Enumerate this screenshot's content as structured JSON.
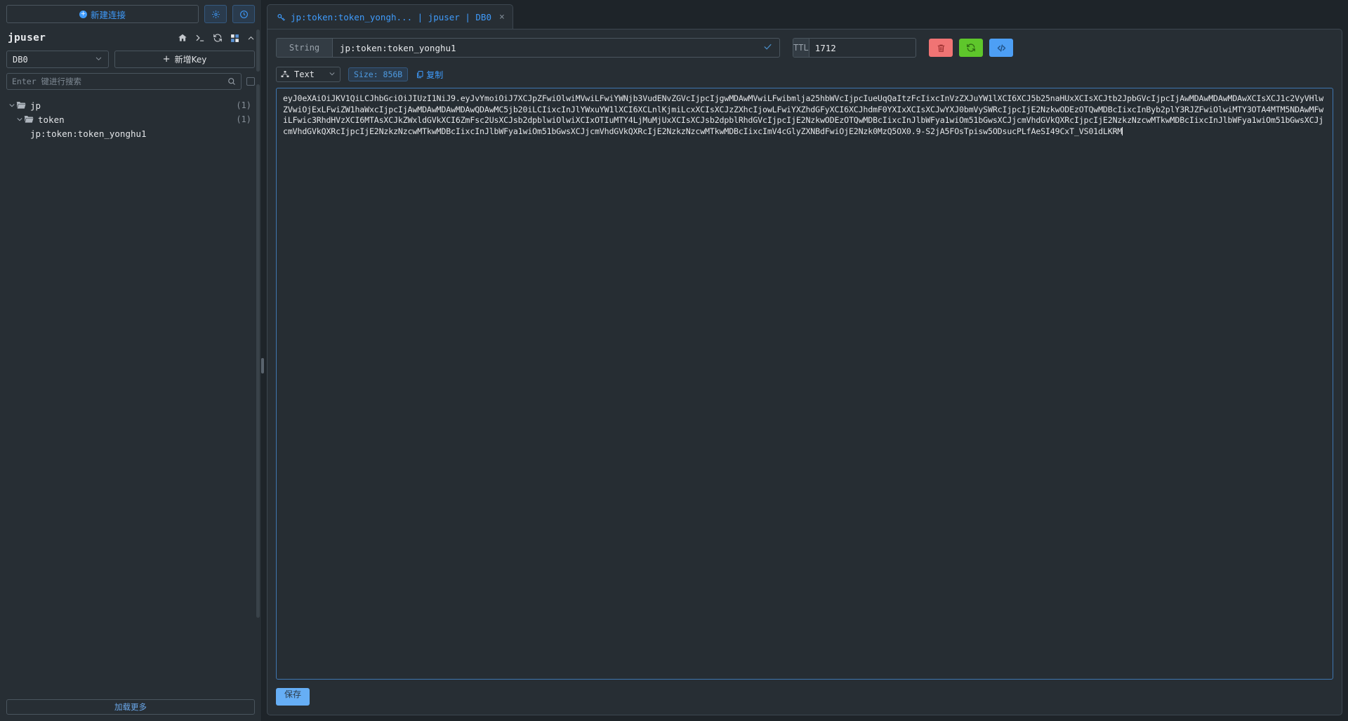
{
  "sidebar": {
    "new_connection_label": "新建连接",
    "settings_icon": "gear-icon",
    "history_icon": "clock-icon",
    "connection_title": "jpuser",
    "title_icons": [
      "home-icon",
      "terminal-icon",
      "refresh-icon",
      "grid-icon",
      "chevron-up-icon"
    ],
    "db_select_value": "DB0",
    "add_key_label": "新增Key",
    "search_placeholder": "Enter 键进行搜索",
    "tree": [
      {
        "label": "jp",
        "count": "(1)",
        "type": "folder",
        "depth": 0,
        "expanded": true
      },
      {
        "label": "token",
        "count": "(1)",
        "type": "folder",
        "depth": 1,
        "expanded": true
      },
      {
        "label": "jp:token:token_yonghu1",
        "count": "",
        "type": "key",
        "depth": 2,
        "expanded": false
      }
    ],
    "load_more_label": "加载更多"
  },
  "tabs": [
    {
      "icon": "key-icon",
      "label": "jp:token:token_yongh...  |  jpuser  |  DB0",
      "close": "×",
      "active": true
    }
  ],
  "key_detail": {
    "type_label": "String",
    "key_name": "jp:token:token_yonghu1",
    "key_confirm_icon": "check-icon",
    "ttl_label": "TTL",
    "ttl_value": "1712",
    "ttl_clear_icon": "close-icon",
    "ttl_confirm_icon": "check-icon",
    "actions": [
      {
        "name": "delete-key-button",
        "icon": "trash-icon",
        "color": "#f07474"
      },
      {
        "name": "refresh-key-button",
        "icon": "refresh-icon",
        "color": "#5ec62b"
      },
      {
        "name": "code-view-button",
        "icon": "code-icon",
        "color": "#4d9ff5"
      }
    ],
    "format_select_value": "Text",
    "format_icon": "chart-icon",
    "size_badge": "Size: 856B",
    "copy_label": "复制",
    "copy_icon": "copy-icon",
    "value_text": "eyJ0eXAiOiJKV1QiLCJhbGciOiJIUzI1NiJ9.eyJvYmoiOiJ7XCJpZFwiOlwiMVwiLFwiYWNjb3VudENvZGVcIjpcIjgwMDAwMVwiLFwibmlja25hbWVcIjpcIueUqQaItzFcIixcInVzZXJuYW1lXCI6XCJ5b25naHUxXCIsXCJtb2JpbGVcIjpcIjAwMDAwMDAwMDAwXCIsXCJ1c2VyVHlwZVwiOjExLFwiZW1haWxcIjpcIjAwMDAwMDAwMDAwQDAwMC5jb20iLCIixcInJlYWxuYW1lXCI6XCLnlKjmiLcxXCIsXCJzZXhcIjowLFwiYXZhdGFyXCI6XCJhdmF0YXIxXCIsXCJwYXJ0bmVySWRcIjpcIjE2NzkwODEzOTQwMDBcIixcInByb2plY3RJZFwiOlwiMTY3OTA4MTM5NDAwMFwiLFwic3RhdHVzXCI6MTAsXCJkZWxldGVkXCI6ZmFsc2UsXCJsb2dpblwiOlwiXCIxOTIuMTY4LjMuMjUxXCIsXCJsb2dpblRhdGVcIjpcIjE2NzkwODEzOTQwMDBcIixcInJlbWFya1wiOm51bGwsXCJjcmVhdGVkQXRcIjpcIjE2NzkzNzcwMTkwMDBcIixcInJlbWFya1wiOm51bGwsXCJjcmVhdGVkQXRcIjpcIjE2NzkzNzcwMTkwMDBcIixcInJlbWFya1wiOm51bGwsXCJjcmVhdGVkQXRcIjE2NzkzNzcwMTkwMDBcIixcImV4cGlyZXNBdFwiOjE2Nzk0MzQ5OX0.9-S2jA5FOsTpisw5ODsucPLfAeSI49CxT_VS01dLKRM",
    "save_label": "保存"
  }
}
